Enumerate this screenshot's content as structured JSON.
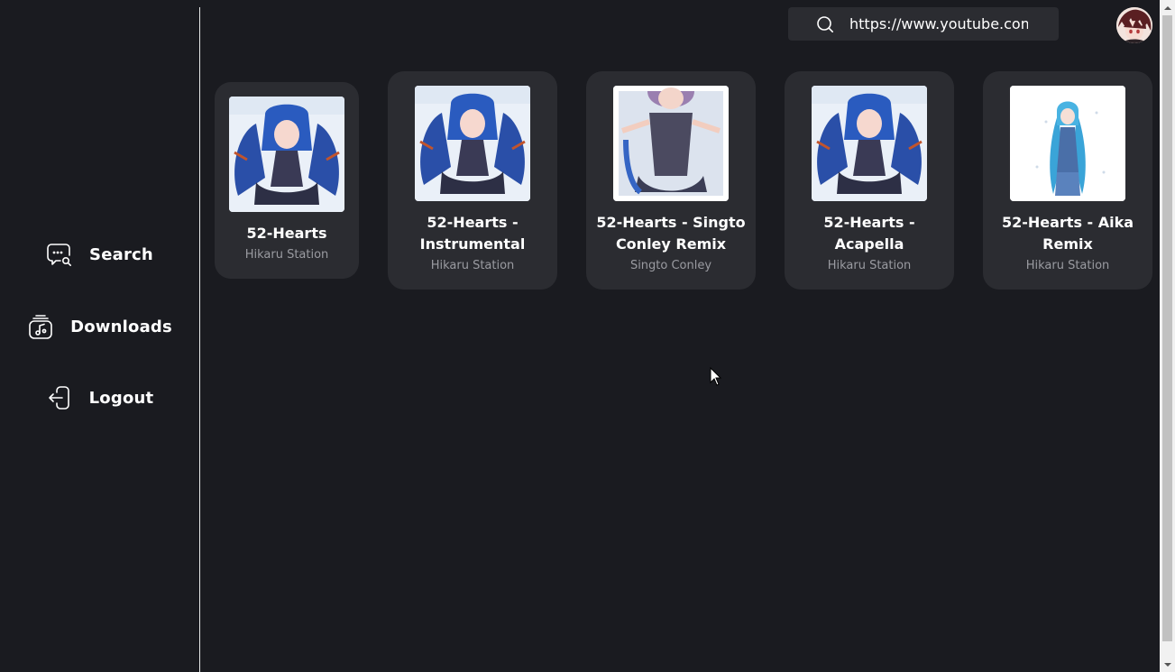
{
  "sidebar": {
    "items": [
      {
        "label": "Search",
        "icon": "search-chat-icon"
      },
      {
        "label": "Downloads",
        "icon": "music-library-icon"
      },
      {
        "label": "Logout",
        "icon": "logout-icon"
      }
    ]
  },
  "header": {
    "search_value": "https://www.youtube.com",
    "search_icon": "search-icon",
    "avatar_icon": "avatar"
  },
  "results": [
    {
      "title": "52-Hearts",
      "artist": "Hikaru Station"
    },
    {
      "title": "52-Hearts - Instrumental",
      "artist": "Hikaru Station"
    },
    {
      "title": "52-Hearts - Singto Conley Remix",
      "artist": "Singto Conley"
    },
    {
      "title": "52-Hearts - Acapella",
      "artist": "Hikaru Station"
    },
    {
      "title": "52-Hearts - Aika Remix",
      "artist": "Hikaru Station"
    }
  ],
  "colors": {
    "background": "#1a1b20",
    "card": "#2b2c31",
    "muted_text": "#9a9ba1"
  }
}
